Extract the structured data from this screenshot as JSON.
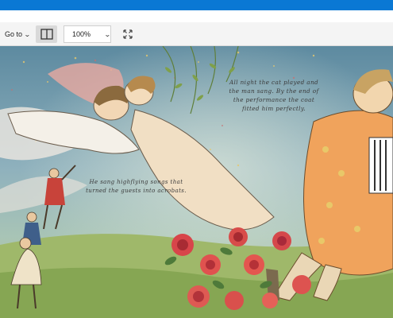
{
  "toolbar": {
    "goto_label": "Go to",
    "zoom_value": "100%"
  },
  "icons": {
    "goto_chevron": "chevron-down-icon",
    "layout": "two-page-layout-icon",
    "zoom_chevron": "chevron-down-icon",
    "fit": "fit-to-page-icon"
  },
  "colors": {
    "titlebar": "#0a78d4",
    "toolbar": "#f4f4f4"
  },
  "book": {
    "text_right": "All night the cat played and the man sang. By the end of the performance the coat fitted him perfectly.",
    "text_left": "He sang highflying songs that turned the guests into acrobats."
  }
}
